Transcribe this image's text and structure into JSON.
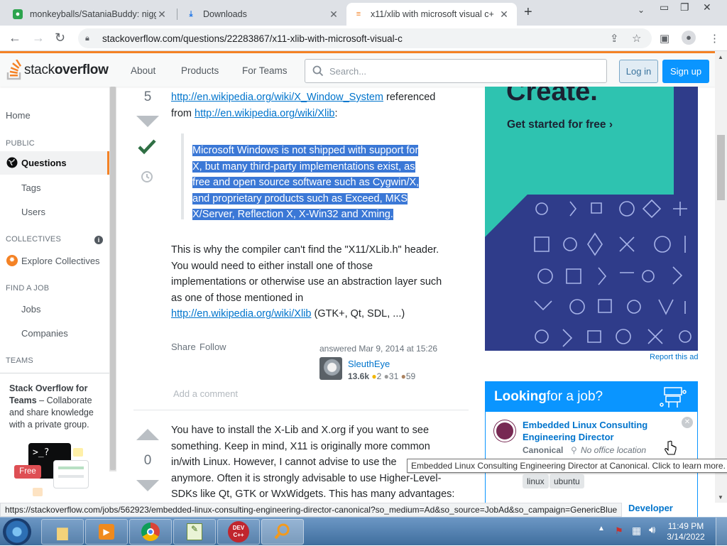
{
  "browser": {
    "tabs": [
      {
        "title": "monkeyballs/SataniaBuddy: nigg"
      },
      {
        "title": "Downloads"
      },
      {
        "title": "x11/xlib with microsoft visual c+"
      }
    ],
    "url": "stackoverflow.com/questions/22283867/x11-xlib-with-microsoft-visual-c"
  },
  "header": {
    "logo_stack": "stack",
    "logo_overflow": "overflow",
    "nav": [
      "About",
      "Products",
      "For Teams"
    ],
    "search_placeholder": "Search...",
    "login": "Log in",
    "signup": "Sign up"
  },
  "sidebar": {
    "home": "Home",
    "public": "PUBLIC",
    "questions": "Questions",
    "tags": "Tags",
    "users": "Users",
    "collectives": "COLLECTIVES",
    "explore_collectives": "Explore Collectives",
    "find_job": "FIND A JOB",
    "jobs": "Jobs",
    "companies": "Companies",
    "teams": "TEAMS",
    "teams_title": "Stack Overflow for Teams",
    "teams_desc": "– Collaborate and share knowledge with a private group.",
    "teams_badge": "Free"
  },
  "answer1": {
    "votes": "5",
    "link1": "http://en.wikipedia.org/wiki/X_Window_System",
    "text1": "referenced",
    "text2": "from",
    "link2": "http://en.wikipedia.org/wiki/Xlib",
    "text3": ":",
    "quote": [
      "Microsoft Windows is not shipped with support for",
      "X, but many third-party implementations exist, as",
      "free and open source software such as Cygwin/X,",
      "and proprietary products such as Exceed, MKS",
      "X/Server, Reflection X, X-Win32 and Xming."
    ],
    "para": [
      "This is why the compiler can't find the \"X11/XLib.h\" header.",
      "You would need to either install one of those",
      "implementations or otherwise use an abstraction layer such",
      "as one of those mentioned in"
    ],
    "link3": "http://en.wikipedia.org/wiki/Xlib",
    "link3_suffix": " (GTK+, Qt, SDL, ...)",
    "share": "Share",
    "follow": "Follow",
    "answered": "answered Mar 9, 2014 at 15:26",
    "user": "SleuthEye",
    "rep": "13.6k",
    "gold": "2",
    "silver": "31",
    "bronze": "59",
    "add_comment": "Add a comment"
  },
  "answer2": {
    "votes": "0",
    "lines": [
      "You have to install the X-Lib and X.org if you want to see",
      "something. Keep in mind, X11 is originally more common",
      "in/with Linux. However, I cannot advise to use the",
      "anymore. Often it is strongly advisable to use Higher-Level-",
      "SDKs like Qt, GTK or WxWidgets. This has many advantages:"
    ]
  },
  "ad": {
    "headline": "Create.",
    "cta": "Get started for free ›",
    "report": "Report this ad"
  },
  "jobs": {
    "title_bold": "Looking",
    "title_rest": " for a job?",
    "job_title": "Embedded Linux Consulting Engineering Director",
    "company": "Canonical",
    "location": "No office location",
    "tags": [
      "linux",
      "ubuntu"
    ],
    "next_job": "Developer"
  },
  "tooltip": "Embedded Linux Consulting Engineering Director at Canonical. Click to learn more.",
  "status_url": "https://stackoverflow.com/jobs/562923/embedded-linux-consulting-engineering-director-canonical?so_medium=Ad&so_source=JobAd&so_campaign=GenericBlue",
  "taskbar": {
    "time": "11:49 PM",
    "date": "3/14/2022",
    "devcpp": "DEV C++"
  }
}
